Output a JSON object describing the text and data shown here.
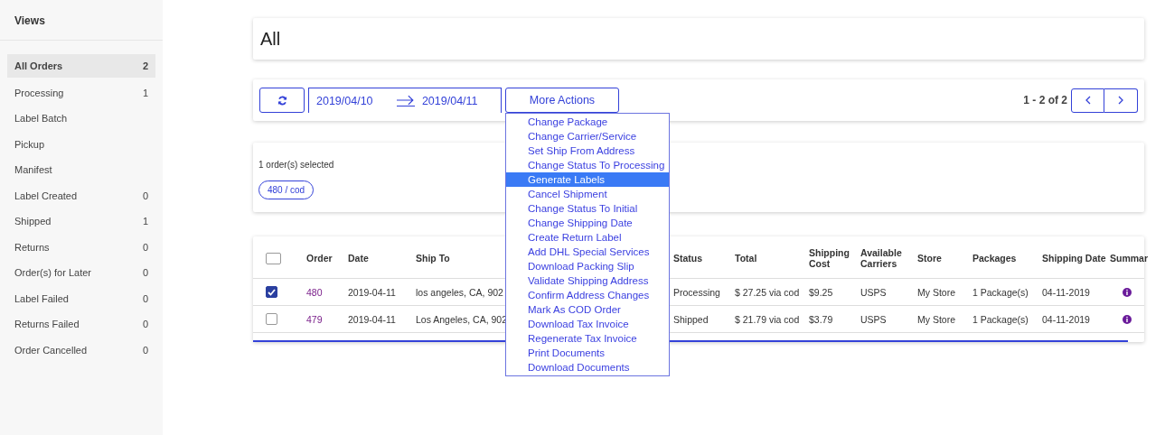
{
  "sidebar": {
    "title": "Views",
    "items": [
      {
        "label": "All Orders",
        "count": "2",
        "selected": true
      },
      {
        "label": "Processing",
        "count": "1",
        "selected": false
      },
      {
        "label": "Label Batch",
        "selected": false
      },
      {
        "label": "Pickup",
        "selected": false
      },
      {
        "label": "Manifest",
        "selected": false
      },
      {
        "label": "Label Created",
        "count": "0",
        "selected": false
      },
      {
        "label": "Shipped",
        "count": "1",
        "selected": false
      },
      {
        "label": "Returns",
        "count": "0",
        "selected": false
      },
      {
        "label": "Order(s) for Later",
        "count": "0",
        "selected": false
      },
      {
        "label": "Label Failed",
        "count": "0",
        "selected": false
      },
      {
        "label": "Returns Failed",
        "count": "0",
        "selected": false
      },
      {
        "label": "Order Cancelled",
        "count": "0",
        "selected": false
      }
    ]
  },
  "page_title": "All",
  "toolbar": {
    "date_from": "2019/04/10",
    "date_to": "2019/04/11",
    "more_actions": "More Actions",
    "pagination": "1 - 2 of 2"
  },
  "menu": {
    "items": [
      {
        "label": "Change Package",
        "selected": false
      },
      {
        "label": "Change Carrier/Service",
        "selected": false
      },
      {
        "label": "Set Ship From Address",
        "selected": false
      },
      {
        "label": "Change Status To Processing",
        "selected": false
      },
      {
        "label": "Generate Labels",
        "selected": true
      },
      {
        "label": "Cancel Shipment",
        "selected": false
      },
      {
        "label": "Change Status To Initial",
        "selected": false
      },
      {
        "label": "Change Shipping Date",
        "selected": false
      },
      {
        "label": "Create Return Label",
        "selected": false
      },
      {
        "label": "Add DHL Special Services",
        "selected": false
      },
      {
        "label": "Download Packing Slip",
        "selected": false
      },
      {
        "label": "Validate Shipping Address",
        "selected": false
      },
      {
        "label": "Confirm Address Changes",
        "selected": false
      },
      {
        "label": "Mark As COD Order",
        "selected": false
      },
      {
        "label": "Download Tax Invoice",
        "selected": false
      },
      {
        "label": "Regenerate Tax Invoice",
        "selected": false
      },
      {
        "label": "Print Documents",
        "selected": false
      },
      {
        "label": "Download Documents",
        "selected": false
      }
    ]
  },
  "selection": {
    "summary": "1 order(s) selected",
    "tags": [
      "480 / cod"
    ]
  },
  "table": {
    "header_checked": false,
    "columns": [
      "Order",
      "Date",
      "Ship To",
      "Status",
      "Total",
      "Shipping Cost",
      "Available Carriers",
      "Store",
      "Packages",
      "Shipping Date",
      "Summar"
    ],
    "rows": [
      {
        "checked": true,
        "cells": [
          "480",
          "2019-04-11",
          "los angeles, CA, 902",
          "Processing",
          "$ 27.25 via cod",
          "$9.25",
          "USPS",
          "My Store",
          "1 Package(s)",
          "04-11-2019"
        ]
      },
      {
        "checked": false,
        "cells": [
          "479",
          "2019-04-11",
          "Los Angeles, CA, 902",
          "Shipped",
          "$ 21.79 via cod",
          "$3.79",
          "USPS",
          "My Store",
          "1 Package(s)",
          "04-11-2019"
        ]
      }
    ]
  }
}
